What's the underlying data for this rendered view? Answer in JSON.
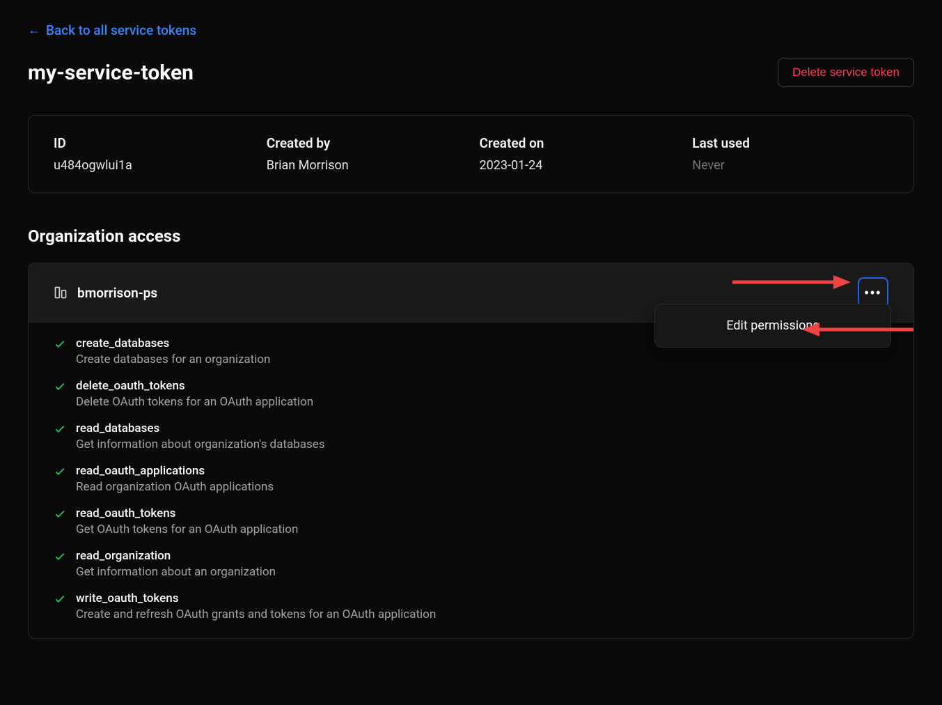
{
  "back_link": "Back to all service tokens",
  "page_title": "my-service-token",
  "delete_button": "Delete service token",
  "info": {
    "id_label": "ID",
    "id_value": "u484ogwlui1a",
    "created_by_label": "Created by",
    "created_by_value": "Brian Morrison",
    "created_on_label": "Created on",
    "created_on_value": "2023-01-24",
    "last_used_label": "Last used",
    "last_used_value": "Never"
  },
  "section_title": "Organization access",
  "org": {
    "name": "bmorrison-ps",
    "dropdown": {
      "edit": "Edit permissions"
    },
    "permissions": [
      {
        "name": "create_databases",
        "desc": "Create databases for an organization"
      },
      {
        "name": "delete_oauth_tokens",
        "desc": "Delete OAuth tokens for an OAuth application"
      },
      {
        "name": "read_databases",
        "desc": "Get information about organization's databases"
      },
      {
        "name": "read_oauth_applications",
        "desc": "Read organization OAuth applications"
      },
      {
        "name": "read_oauth_tokens",
        "desc": "Get OAuth tokens for an OAuth application"
      },
      {
        "name": "read_organization",
        "desc": "Get information about an organization"
      },
      {
        "name": "write_oauth_tokens",
        "desc": "Create and refresh OAuth grants and tokens for an OAuth application"
      }
    ]
  }
}
